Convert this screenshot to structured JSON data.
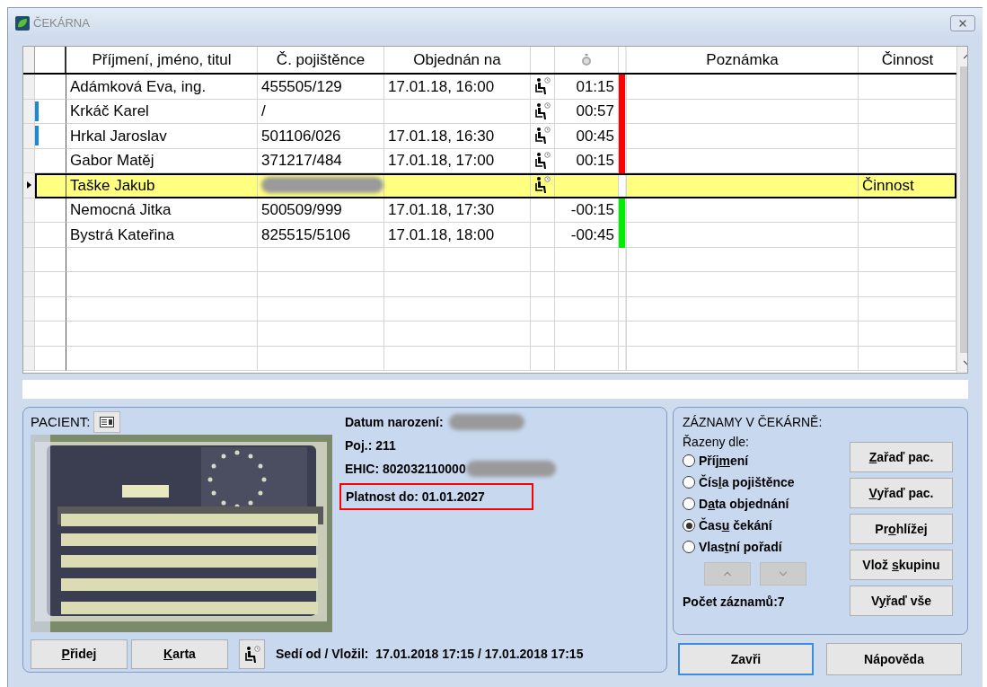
{
  "window": {
    "title": "ČEKÁRNA"
  },
  "columns": {
    "name": "Příjmení, jméno, titul",
    "insurance": "Č. pojištěnce",
    "ordered": "Objednán na",
    "note": "Poznámka",
    "activity": "Činnost"
  },
  "rows": [
    {
      "name": "Adámková Eva, ing.",
      "insurance": "455505/129",
      "ordered": "17.01.18, 16:00",
      "seated": true,
      "wait": "01:15",
      "color": "#ff0000",
      "flagged": false,
      "selected": false
    },
    {
      "name": "Krkáč Karel",
      "insurance": "/",
      "seated": true,
      "wait": "00:57",
      "color": "#ff0000",
      "flagged": true,
      "selected": false
    },
    {
      "name": "Hrkal Jaroslav",
      "insurance": "501106/026",
      "ordered": "17.01.18, 16:30",
      "seated": true,
      "wait": "00:45",
      "color": "#ff0000",
      "flagged": true,
      "selected": false
    },
    {
      "name": "Gabor Matěj",
      "insurance": "371217/484",
      "ordered": "17.01.18, 17:00",
      "seated": true,
      "wait": "00:15",
      "color": "#ff0000",
      "flagged": false,
      "selected": false
    },
    {
      "name": "Taške Jakub",
      "insurance_redacted": true,
      "seated": true,
      "activity": "Činnost",
      "flagged": false,
      "selected": true
    },
    {
      "name": "Nemocná Jitka",
      "insurance": "500509/999",
      "ordered": "17.01.18, 17:30",
      "seated": false,
      "wait": "-00:15",
      "color": "#00ee00",
      "flagged": false,
      "selected": false
    },
    {
      "name": "Bystrá Kateřina",
      "insurance": "825515/5106",
      "ordered": "17.01.18, 18:00",
      "seated": false,
      "wait": "-00:45",
      "color": "#00ee00",
      "flagged": false,
      "selected": false
    }
  ],
  "patient": {
    "label": "PACIENT:",
    "birth_label": "Datum narození:",
    "birth_redacted": true,
    "insurer": "Poj.: 211",
    "ehic": "EHIC: 802032110000",
    "ehic_redacted": true,
    "validity": "Platnost do: 01.01.2027",
    "validity_highlighted": true,
    "buttons": [
      {
        "key": "P",
        "post": "řidej"
      },
      {
        "key": "K",
        "post": "arta"
      }
    ],
    "seated_since": "Sedí od / Vložil:  17.01.2018 17:15 / 17.01.2018 17:15"
  },
  "records": {
    "title": "ZÁZNAMY V ČEKÁRNĚ:",
    "sort_label": "Řazeny dle:",
    "sort_options": [
      {
        "pre": "Příj",
        "key": "m",
        "post": "ení",
        "selected": false
      },
      {
        "pre": "Čís",
        "key": "l",
        "post": "a pojištěnce",
        "selected": false
      },
      {
        "pre": "D",
        "key": "a",
        "post": "ta objednání",
        "selected": false
      },
      {
        "pre": "Čas",
        "key": "u",
        "post": " čekání",
        "selected": true
      },
      {
        "pre": "Vlas",
        "key": "t",
        "post": "ní pořadí",
        "selected": false
      }
    ],
    "move_disabled": true,
    "count": "Počet záznamů:7",
    "buttons": [
      {
        "key": "Z",
        "post": "ařaď pac."
      },
      {
        "key": "V",
        "post": "yřaď pac."
      },
      {
        "pre": "Pr",
        "key": "o",
        "post": "hlížej"
      },
      {
        "pre": "Vlož ",
        "key": "s",
        "post": "kupinu"
      },
      {
        "pre": "V",
        "key": "y",
        "post": "řaď vše"
      }
    ]
  },
  "footer_buttons": [
    {
      "label": "Zavři",
      "default": true
    },
    {
      "label": "Nápověda",
      "default": false
    }
  ]
}
